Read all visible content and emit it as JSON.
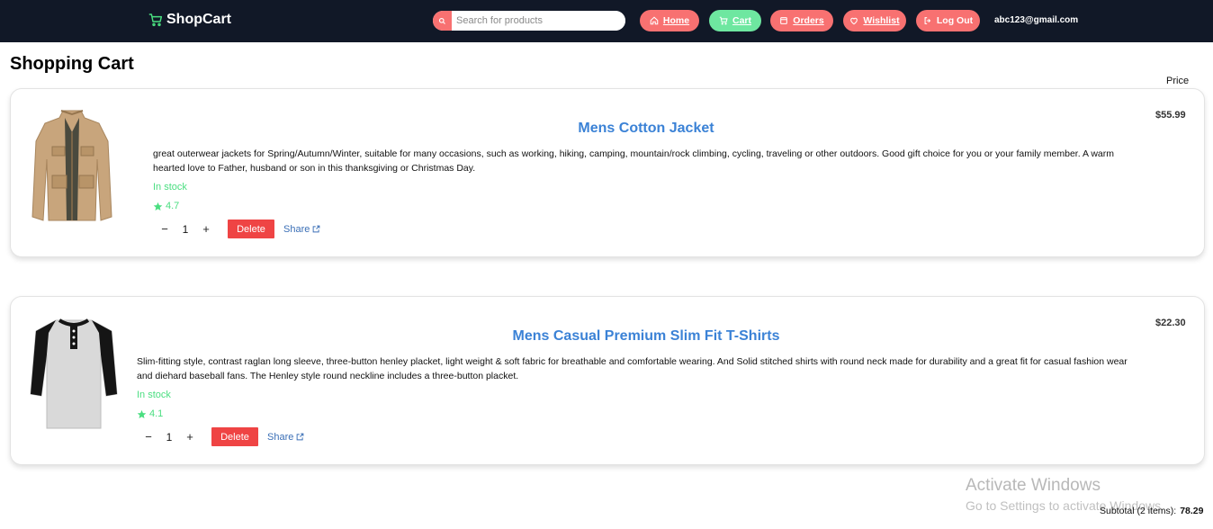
{
  "nav": {
    "brand": "ShopCart",
    "search_placeholder": "Search for products",
    "home": "Home",
    "cart": "Cart",
    "orders": "Orders",
    "wishlist": "Wishlist",
    "logout": "Log Out",
    "email": "abc123@gmail.com"
  },
  "page": {
    "title": "Shopping Cart",
    "price_heading": "Price"
  },
  "items": [
    {
      "title": "Mens Cotton Jacket",
      "description": "great outerwear jackets for Spring/Autumn/Winter, suitable for many occasions, such as working, hiking, camping, mountain/rock climbing, cycling, traveling or other outdoors. Good gift choice for you or your family member. A warm hearted love to Father, husband or son in this thanksgiving or Christmas Day.",
      "stock": "In stock",
      "rating": "4.7",
      "quantity": "1",
      "minus": "−",
      "plus": "+",
      "delete": "Delete",
      "share": "Share",
      "price": "$55.99"
    },
    {
      "title": "Mens Casual Premium Slim Fit T-Shirts",
      "description": "Slim-fitting style, contrast raglan long sleeve, three-button henley placket, light weight & soft fabric for breathable and comfortable wearing. And Solid stitched shirts with round neck made for durability and a great fit for casual fashion wear and diehard baseball fans. The Henley style round neckline includes a three-button placket.",
      "stock": "In stock",
      "rating": "4.1",
      "quantity": "1",
      "minus": "−",
      "plus": "+",
      "delete": "Delete",
      "share": "Share",
      "price": "$22.30"
    }
  ],
  "subtotal": {
    "label": "Subtotal (2 items):",
    "value": "78.29"
  },
  "watermark": {
    "line1": "Activate Windows",
    "line2": "Go to Settings to activate Windows."
  },
  "colors": {
    "navbar": "#111827",
    "accent": "#f87171",
    "cart_active": "#6ee7a0",
    "title_blue": "#3b82d6",
    "in_stock": "#4ade80",
    "delete": "#ef4444"
  }
}
